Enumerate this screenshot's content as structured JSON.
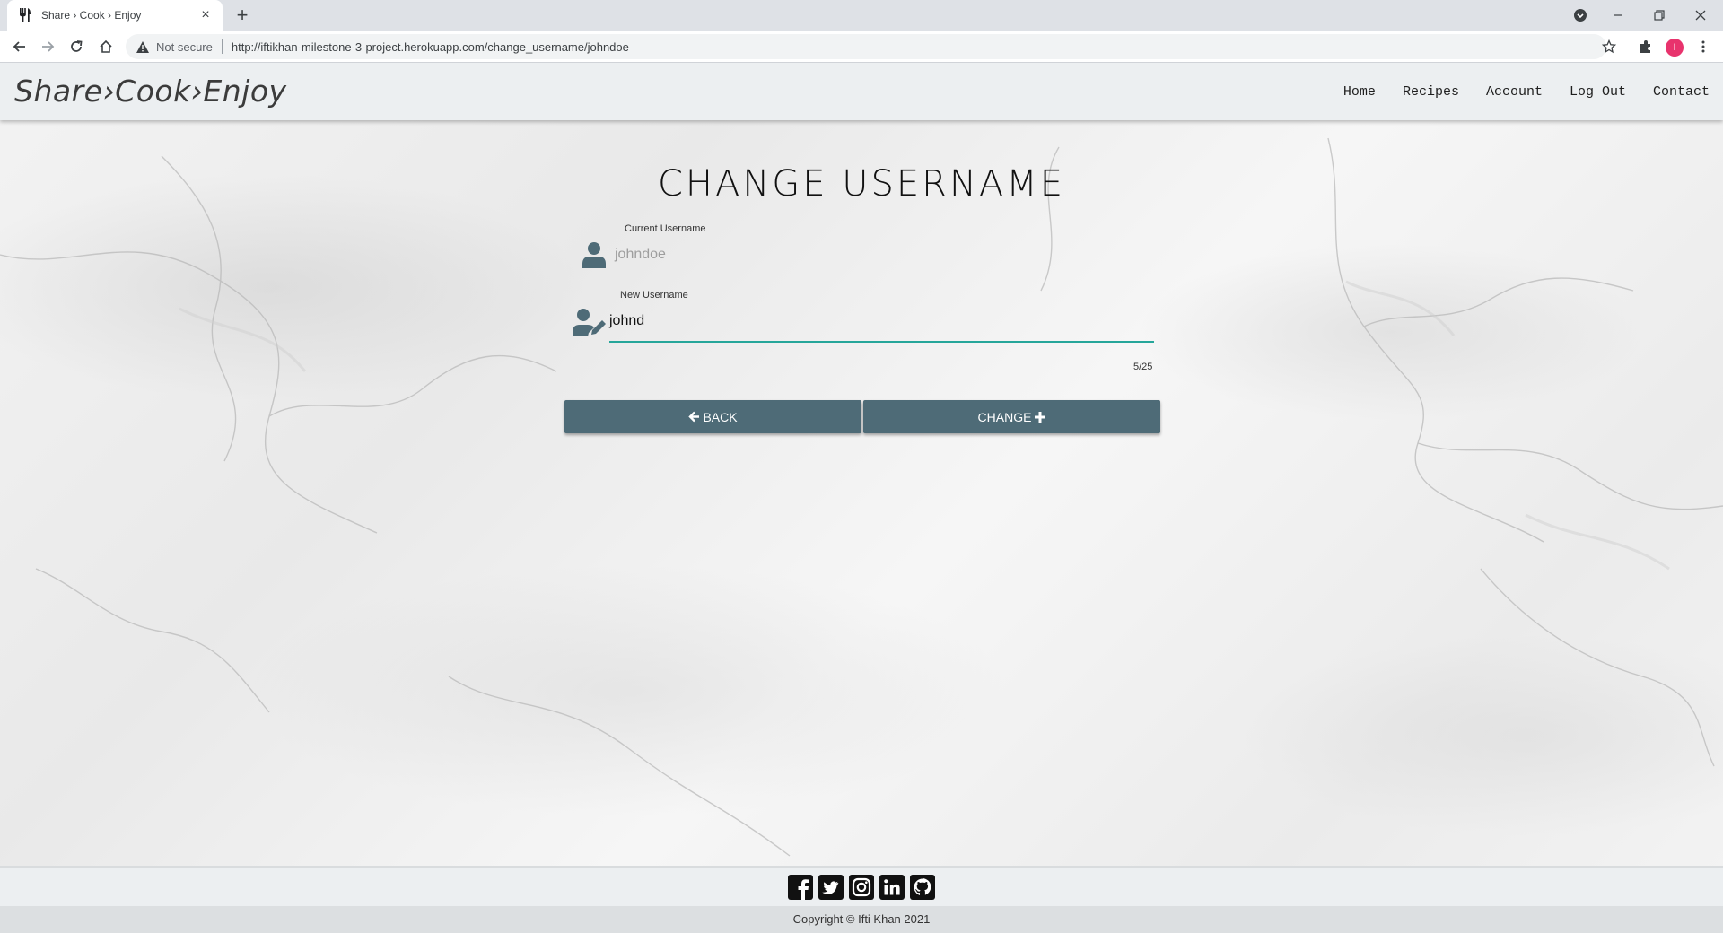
{
  "browser": {
    "tab_title": "Share › Cook › Enjoy",
    "tab_close": "×",
    "new_tab": "+",
    "security_label": "Not secure",
    "url": "http://iftikhan-milestone-3-project.herokuapp.com/change_username/johndoe",
    "profile_initial": "I"
  },
  "navbar": {
    "brand": "Share›Cook›Enjoy",
    "links": [
      "Home",
      "Recipes",
      "Account",
      "Log Out",
      "Contact"
    ]
  },
  "form": {
    "heading": "CHANGE USERNAME",
    "current_label": "Current Username",
    "current_value": "johndoe",
    "new_label": "New Username",
    "new_value": "johnd",
    "counter": "5/25",
    "back_label": "BACK",
    "change_label": "CHANGE"
  },
  "footer": {
    "social_icons": [
      "facebook-icon",
      "twitter-icon",
      "instagram-icon",
      "linkedin-icon",
      "github-icon"
    ],
    "copyright": "Copyright © Ifti Khan 2021"
  },
  "colors": {
    "button": "#4e6b77",
    "icon": "#4e6b77",
    "active_underline": "#26a69a",
    "navbar": "#eceff1"
  }
}
